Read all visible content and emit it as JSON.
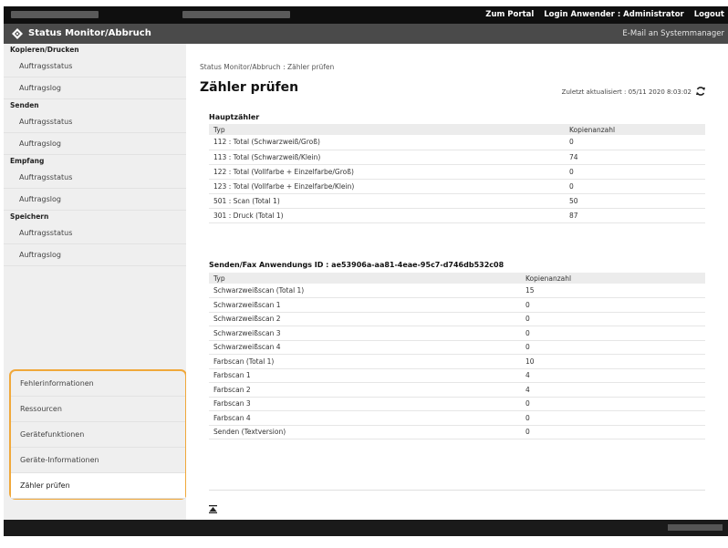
{
  "topbar": {
    "links": [
      "Zum Portal",
      "Login Anwender : Administrator",
      "Logout"
    ]
  },
  "header": {
    "title": "Status Monitor/Abbruch",
    "mail": "E-Mail an Systemmanager"
  },
  "sidebar": {
    "sections": [
      {
        "label": "Kopieren/Drucken",
        "items": [
          "Auftragsstatus",
          "Auftragslog"
        ]
      },
      {
        "label": "Senden",
        "items": [
          "Auftragsstatus",
          "Auftragslog"
        ]
      },
      {
        "label": "Empfang",
        "items": [
          "Auftragsstatus",
          "Auftragslog"
        ]
      },
      {
        "label": "Speichern",
        "items": [
          "Auftragsstatus",
          "Auftragslog"
        ]
      }
    ],
    "extra": [
      "Fehlerinformationen",
      "Ressourcen",
      "Gerätefunktionen",
      "Geräte-Informationen",
      "Zähler prüfen"
    ]
  },
  "main": {
    "breadcrumb": "Status Monitor/Abbruch : Zähler prüfen",
    "title": "Zähler prüfen",
    "updated": "Zuletzt aktualisiert : 05/11 2020 8:03:02",
    "main_counter": {
      "heading": "Hauptzähler",
      "headers": [
        "Typ",
        "Kopienanzahl"
      ],
      "rows": [
        [
          "112 : Total (Schwarzweiß/Groß)",
          "0"
        ],
        [
          "113 : Total (Schwarzweiß/Klein)",
          "74"
        ],
        [
          "122 : Total (Vollfarbe + Einzelfarbe/Groß)",
          "0"
        ],
        [
          "123 : Total (Vollfarbe + Einzelfarbe/Klein)",
          "0"
        ],
        [
          "501 : Scan (Total 1)",
          "50"
        ],
        [
          "301 : Druck (Total 1)",
          "87"
        ]
      ]
    },
    "send_counter": {
      "heading": "Senden/Fax Anwendungs ID : ae53906a-aa81-4eae-95c7-d746db532c08",
      "headers": [
        "Typ",
        "Kopienanzahl"
      ],
      "rows": [
        [
          "Schwarzweißscan (Total 1)",
          "15"
        ],
        [
          "Schwarzweißscan 1",
          "0"
        ],
        [
          "Schwarzweißscan 2",
          "0"
        ],
        [
          "Schwarzweißscan 3",
          "0"
        ],
        [
          "Schwarzweißscan 4",
          "0"
        ],
        [
          "Farbscan (Total 1)",
          "10"
        ],
        [
          "Farbscan 1",
          "4"
        ],
        [
          "Farbscan 2",
          "4"
        ],
        [
          "Farbscan 3",
          "0"
        ],
        [
          "Farbscan 4",
          "0"
        ],
        [
          "Senden (Textversion)",
          "0"
        ]
      ]
    }
  },
  "colors": {
    "topbar": "#0f0f0f",
    "header": "#4a4a4a",
    "sidebar": "#efefef",
    "highlight": "#f0a83a"
  },
  "icons": [
    "logo-icon",
    "refresh-icon",
    "back-to-top-icon"
  ]
}
